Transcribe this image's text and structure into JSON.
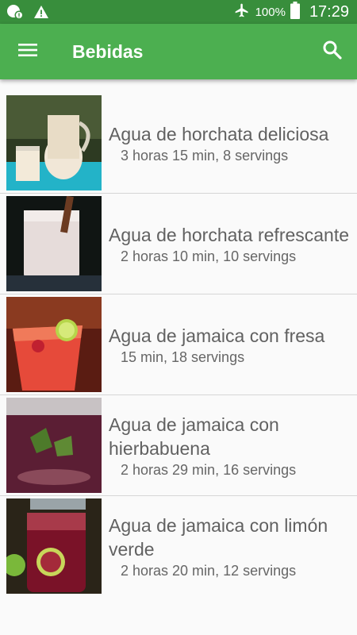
{
  "status_bar": {
    "battery_pct": "100%",
    "time": "17:29",
    "icons": [
      "notification-icon",
      "warning-icon",
      "airplane-mode-icon",
      "battery-icon"
    ]
  },
  "app_bar": {
    "title": "Bebidas",
    "icons": [
      "menu-icon",
      "search-icon"
    ],
    "color": "#4caf50",
    "status_color": "#388e3c"
  },
  "recipes": [
    {
      "title": "Agua de horchata deliciosa",
      "subtitle": "3 horas 15 min, 8 servings"
    },
    {
      "title": "Agua de horchata refrescante",
      "subtitle": "2 horas 10 min, 10 servings"
    },
    {
      "title": "Agua de jamaica con fresa",
      "subtitle": "15 min, 18 servings"
    },
    {
      "title": "Agua de jamaica con hierbabuena",
      "subtitle": "2 horas 29 min, 16 servings"
    },
    {
      "title": "Agua de jamaica con limón verde",
      "subtitle": "2 horas 20 min, 12 servings"
    }
  ]
}
